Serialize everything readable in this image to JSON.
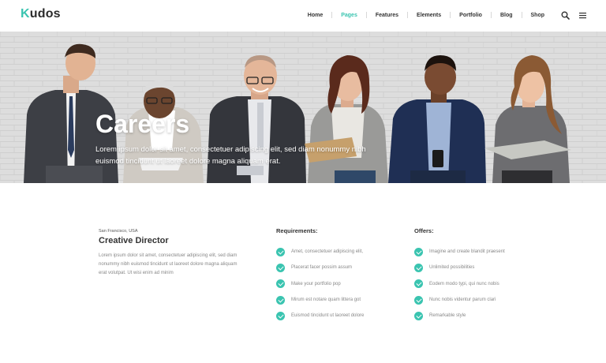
{
  "brand": {
    "logo_letter": "K",
    "logo_rest": "udos",
    "accent": "#3ac4b0"
  },
  "nav": {
    "items": [
      "Home",
      "Pages",
      "Features",
      "Elements",
      "Portfolio",
      "Blog",
      "Shop"
    ],
    "active": "Pages",
    "icons": [
      "search-icon",
      "menu-icon"
    ]
  },
  "hero": {
    "title": "Careers",
    "description": "Lorem ipsum dolor sit amet, consectetuer adipiscing elit, sed diam nonummy nibh euismod tincidunt ut laoreet dolore magna aliquam erat."
  },
  "job": {
    "location": "San Francisco, USA",
    "title": "Creative Director",
    "description": "Lorem ipsum dolor sit amet, consectetuer adipiscing elit, sed diam nonummy nibh euismod tincidunt ut laoreet dolore magna aliquam erat volutpat. Ut wisi enim ad minim"
  },
  "requirements": {
    "title": "Requirements:",
    "items": [
      "Amet, consectetuer adipiscing elit,",
      "Placerat facer possim assum",
      "Make your portfolio pop",
      "Mirum est notare quam littera got",
      "Euismod tincidunt ut laoreet dolore"
    ]
  },
  "offers": {
    "title": "Offers:",
    "items": [
      "Imagine and create blandit praesent",
      "Unlimited possibilities",
      "Eodem modo typi, qui nunc nobis",
      "Nunc nobis videntur parum clari",
      "Remarkable style"
    ]
  }
}
